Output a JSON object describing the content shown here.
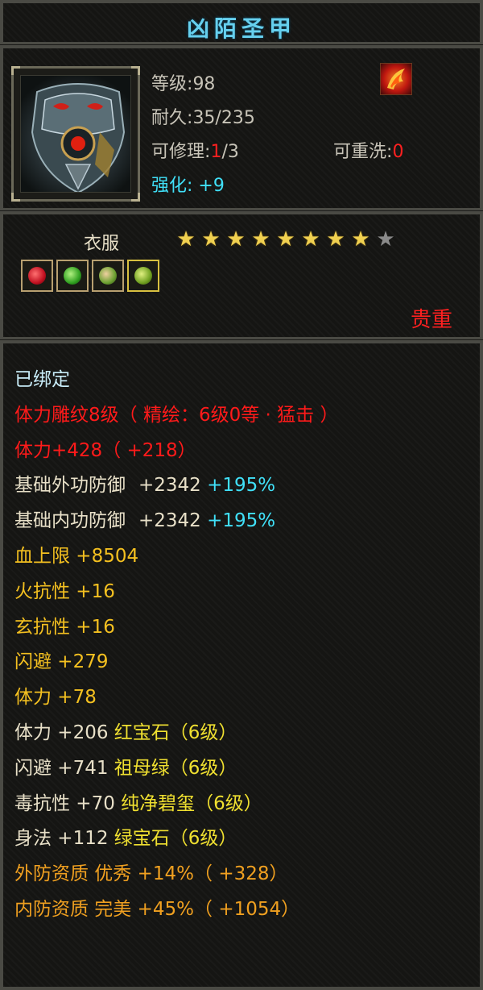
{
  "item": {
    "name": "凶陌圣甲",
    "level_label": "等级",
    "level": "98",
    "durability_label": "耐久",
    "durability": "35/235",
    "repair_label": "可修理",
    "repair_used": "1",
    "repair_total": "/3",
    "rewash_label": "可重洗",
    "rewash_value": "0",
    "enhance_label": "强化",
    "enhance_value": "+9",
    "category": "衣服",
    "stars_filled": 8,
    "stars_total": 9,
    "rarity": "贵重",
    "icon": "chest-armor-icon",
    "enhance_icon": "fire-phoenix-icon",
    "gems": [
      "ruby-gem-icon",
      "emerald-gem-icon",
      "jade-gem-icon",
      "peridot-gem-icon"
    ]
  },
  "attributes": {
    "bound": "已绑定",
    "engrave": "体力雕纹8级（ 精绘：6级0等 · 猛击 ）",
    "stamina_main": "体力+428（ +218）",
    "ext_def_label": "基础外功防御",
    "ext_def_value": "+2342",
    "ext_def_pct": "+195%",
    "int_def_label": "基础内功防御",
    "int_def_value": "+2342",
    "int_def_pct": "+195%",
    "hp_cap": "血上限  +8504",
    "fire_res": "火抗性  +16",
    "mystic_res": "玄抗性  +16",
    "dodge": "闪避  +279",
    "stamina": "体力  +78",
    "gem1_stat": "体力  +206",
    "gem1_name": "红宝石（6级）",
    "gem2_stat": "闪避  +741",
    "gem2_name": "祖母绿（6级）",
    "gem3_stat": "毒抗性  +70",
    "gem3_name": "纯净碧玺（6级）",
    "gem4_stat": "身法  +112",
    "gem4_name": "绿宝石（6级）",
    "ext_quality": "外防资质    优秀  +14%（ +328）",
    "int_quality": "内防资质    完美  +45%（ +1054）"
  },
  "colors": {
    "title": "#66d0ee",
    "red": "#ff1a1a",
    "gold": "#f4c020",
    "orange": "#f0a020",
    "cyan": "#40e0f8"
  }
}
